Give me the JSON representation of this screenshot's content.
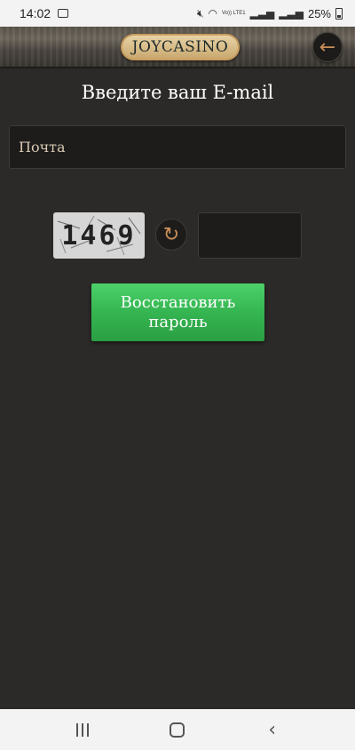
{
  "status_bar": {
    "time": "14:02",
    "network_label": "Vo)) LTE1",
    "battery": "25%"
  },
  "header": {
    "logo_text": "JOYCASINO",
    "back_icon": "arrow-left-icon"
  },
  "form": {
    "title": "Введите ваш E-mail",
    "email_placeholder": "Почта",
    "email_value": "",
    "captcha_text": "1469",
    "captcha_input_value": "",
    "refresh_icon": "refresh-icon",
    "submit_line1": "Восстановить",
    "submit_line2": "пароль"
  },
  "colors": {
    "background": "#2c2a28",
    "accent_green": "#35b551",
    "accent_copper": "#c98e58"
  },
  "navbar": {
    "recent_icon": "recent-apps-icon",
    "home_icon": "home-icon",
    "back_icon": "chevron-left-icon"
  }
}
